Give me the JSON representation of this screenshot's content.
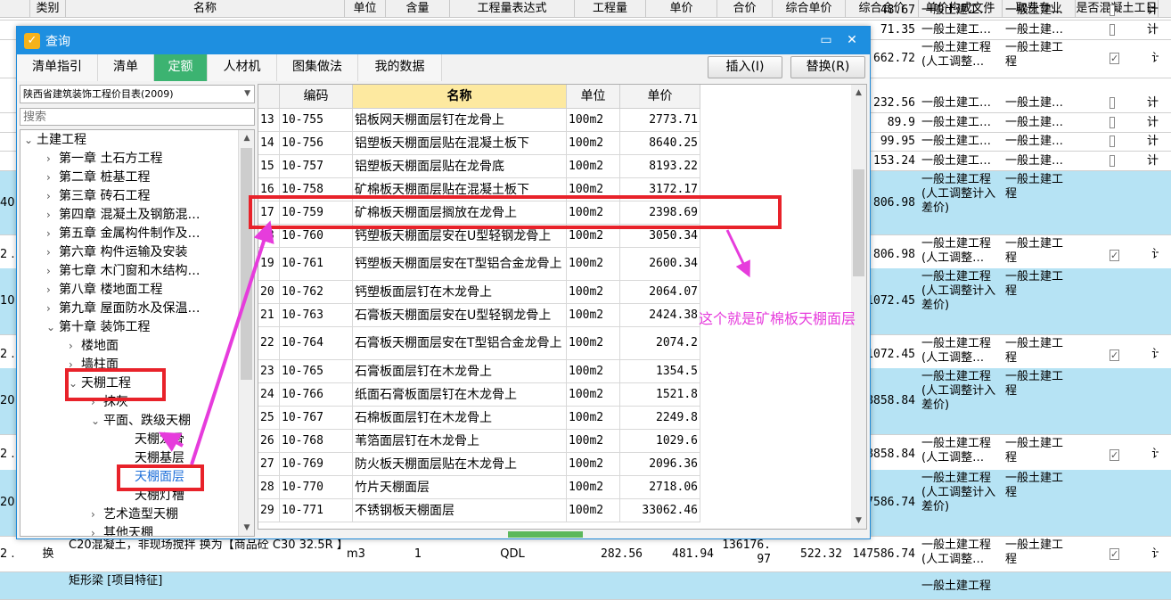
{
  "dialog": {
    "title": "查询",
    "minimize_glyph": "▭",
    "close_glyph": "✕",
    "tabs": [
      "清单指引",
      "清单",
      "定额",
      "人材机",
      "图集做法",
      "我的数据"
    ],
    "active_tab": 2,
    "insert_button": "插入(I)",
    "replace_button": "替换(R)",
    "library_select": "陕西省建筑装饰工程价目表(2009)",
    "search_placeholder": "搜索"
  },
  "tree": [
    {
      "label": "土建工程",
      "arrow": "v"
    },
    {
      "label": "第一章 土石方工程",
      "arrow": ">"
    },
    {
      "label": "第二章 桩基工程",
      "arrow": ">"
    },
    {
      "label": "第三章 砖石工程",
      "arrow": ">"
    },
    {
      "label": "第四章 混凝土及钢筋混…",
      "arrow": ">"
    },
    {
      "label": "第五章 金属构件制作及…",
      "arrow": ">"
    },
    {
      "label": "第六章 构件运输及安装",
      "arrow": ">"
    },
    {
      "label": "第七章 木门窗和木结构…",
      "arrow": ">"
    },
    {
      "label": "第八章 楼地面工程",
      "arrow": ">"
    },
    {
      "label": "第九章 屋面防水及保温…",
      "arrow": ">"
    },
    {
      "label": "第十章 装饰工程",
      "arrow": "v"
    },
    {
      "label": "楼地面",
      "arrow": ">"
    },
    {
      "label": "墙柱面",
      "arrow": ">"
    },
    {
      "label": "天棚工程",
      "arrow": "v"
    },
    {
      "label": "抹灰",
      "arrow": ">"
    },
    {
      "label": "平面、跌级天棚",
      "arrow": "v"
    },
    {
      "label": "天棚龙骨",
      "arrow": ""
    },
    {
      "label": "天棚基层",
      "arrow": ""
    },
    {
      "label": "天棚面层",
      "arrow": "",
      "selected": true
    },
    {
      "label": "天棚灯槽",
      "arrow": ""
    },
    {
      "label": "艺术造型天棚",
      "arrow": ">"
    },
    {
      "label": "其他天棚",
      "arrow": ">"
    }
  ],
  "grid": {
    "headers": [
      "",
      "编码",
      "名称",
      "单位",
      "单价"
    ],
    "rows": [
      {
        "no": "13",
        "code": "10-755",
        "name": "铝板网天棚面层钉在龙骨上",
        "unit": "100m2",
        "price": "2773.71"
      },
      {
        "no": "14",
        "code": "10-756",
        "name": "铝塑板天棚面层贴在混凝土板下",
        "unit": "100m2",
        "price": "8640.25"
      },
      {
        "no": "15",
        "code": "10-757",
        "name": "铝塑板天棚面层贴在龙骨底",
        "unit": "100m2",
        "price": "8193.22"
      },
      {
        "no": "16",
        "code": "10-758",
        "name": "矿棉板天棚面层贴在混凝土板下",
        "unit": "100m2",
        "price": "3172.17"
      },
      {
        "no": "17",
        "code": "10-759",
        "name": "矿棉板天棚面层搁放在龙骨上",
        "unit": "100m2",
        "price": "2398.69"
      },
      {
        "no": "18",
        "code": "10-760",
        "name": "钙塑板天棚面层安在U型轻钢龙骨上",
        "unit": "100m2",
        "price": "3050.34"
      },
      {
        "no": "19",
        "code": "10-761",
        "name": "钙塑板天棚面层安在T型铝合金龙骨上",
        "unit": "100m2",
        "price": "2600.34"
      },
      {
        "no": "20",
        "code": "10-762",
        "name": "钙塑板面层钉在木龙骨上",
        "unit": "100m2",
        "price": "2064.07"
      },
      {
        "no": "21",
        "code": "10-763",
        "name": "石膏板天棚面层安在U型轻钢龙骨上",
        "unit": "100m2",
        "price": "2424.38"
      },
      {
        "no": "22",
        "code": "10-764",
        "name": "石膏板天棚面层安在T型铝合金龙骨上",
        "unit": "100m2",
        "price": "2074.2"
      },
      {
        "no": "23",
        "code": "10-765",
        "name": "石膏板面层钉在木龙骨上",
        "unit": "100m2",
        "price": "1354.5"
      },
      {
        "no": "24",
        "code": "10-766",
        "name": "纸面石膏板面层钉在木龙骨上",
        "unit": "100m2",
        "price": "1521.8"
      },
      {
        "no": "25",
        "code": "10-767",
        "name": "石棉板面层钉在木龙骨上",
        "unit": "100m2",
        "price": "2249.8"
      },
      {
        "no": "26",
        "code": "10-768",
        "name": "苇箔面层钉在木龙骨上",
        "unit": "100m2",
        "price": "1029.6"
      },
      {
        "no": "27",
        "code": "10-769",
        "name": "防火板天棚面层贴在木龙骨上",
        "unit": "100m2",
        "price": "2096.36"
      },
      {
        "no": "28",
        "code": "10-770",
        "name": "竹片天棚面层",
        "unit": "100m2",
        "price": "2718.06"
      },
      {
        "no": "29",
        "code": "10-771",
        "name": "不锈钢板天棚面层",
        "unit": "100m2",
        "price": "33062.46"
      }
    ]
  },
  "annotation": {
    "text": "这个就是矿棉板天棚面层",
    "color": "#e63cdc"
  },
  "spreadsheet": {
    "headers": [
      "",
      "类别",
      "名称",
      "单位",
      "含量",
      "工程量表达式",
      "工程量",
      "单价",
      "合价",
      "综合单价",
      "综合合价",
      "单价构成文件",
      "取费专业",
      "是否混凝土工日"
    ],
    "rows": [
      {
        "left": "",
        "total": "48.67",
        "file": "一般土建工…",
        "fee": "一般土建…",
        "check": false,
        "last": "计",
        "blue": false
      },
      {
        "left": "",
        "total": "71.35",
        "file": "一般土建工…",
        "fee": "一般土建…",
        "check": false,
        "last": "计",
        "blue": false
      },
      {
        "left": "",
        "total": "662.72",
        "file": "一般土建工程(人工调整…",
        "fee": "一般土建工程",
        "check": true,
        "last": "计",
        "blue": false
      },
      {
        "left": "",
        "total": "232.56",
        "file": "一般土建工…",
        "fee": "一般土建…",
        "check": false,
        "last": "计",
        "blue": false
      },
      {
        "left": "",
        "total": "89.9",
        "file": "一般土建工…",
        "fee": "一般土建…",
        "check": false,
        "last": "计",
        "blue": false
      },
      {
        "left": "",
        "total": "99.95",
        "file": "一般土建工…",
        "fee": "一般土建…",
        "check": false,
        "last": "计",
        "blue": false
      },
      {
        "left": "",
        "total": "153.24",
        "file": "一般土建工…",
        "fee": "一般土建…",
        "check": false,
        "last": "计",
        "blue": false
      },
      {
        "left": "40",
        "total": "806.98",
        "file": "一般土建工程(人工调整计入差价)",
        "fee": "一般土建工程",
        "check": false,
        "last": "",
        "blue": true
      },
      {
        "left": "2 .",
        "total": "806.98",
        "file": "一般土建工程(人工调整…",
        "fee": "一般土建工程",
        "check": true,
        "last": "计",
        "blue": false
      },
      {
        "left": "10",
        "total": "1072.45",
        "file": "一般土建工程(人工调整计入差价)",
        "fee": "一般土建工程",
        "check": false,
        "last": "",
        "blue": true
      },
      {
        "left": "2 .",
        "total": "1072.45",
        "file": "一般土建工程(人工调整…",
        "fee": "一般土建工程",
        "check": true,
        "last": "计",
        "blue": false
      },
      {
        "left": "20",
        "total": "8858.84",
        "file": "一般土建工程(人工调整计入差价)",
        "fee": "一般土建工程",
        "check": false,
        "last": "",
        "blue": true
      },
      {
        "left": "2 .",
        "total": "8858.84",
        "file": "一般土建工程(人工调整…",
        "fee": "一般土建工程",
        "check": true,
        "last": "计",
        "blue": false
      },
      {
        "left": "20",
        "total": "147586.74",
        "file": "一般土建工程(人工调整计入差价)",
        "fee": "一般土建工程",
        "check": false,
        "last": "",
        "blue": true
      },
      {
        "left": "2 .",
        "total": "147586.74",
        "file": "一般土建工程(人工调整…",
        "fee": "一般土建工程",
        "check": true,
        "last": "计",
        "blue": false,
        "type": "换",
        "name": "C20混凝土，非现场搅拌 换为【商品砼 C30 32.5R 】",
        "unit": "m3",
        "content": "1",
        "expr": "QDL",
        "qty": "282.56",
        "price": "481.94",
        "amount": "136176.97",
        "unit_price": "522.32"
      },
      {
        "left": "",
        "total": "",
        "file": "一般土建工程",
        "fee": "",
        "check": false,
        "last": "",
        "blue": true,
        "name": "矩形梁 [项目特征]"
      }
    ]
  }
}
